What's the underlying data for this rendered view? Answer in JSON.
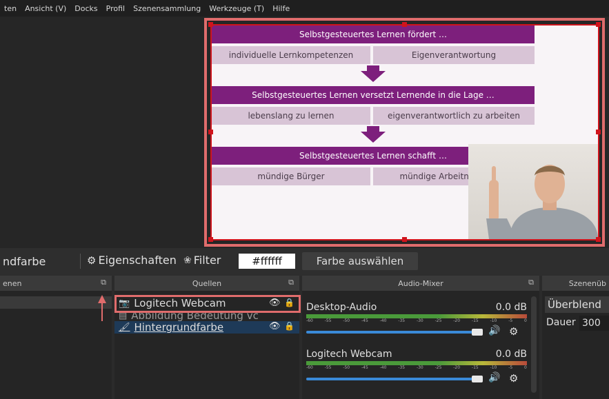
{
  "menu": [
    "ten",
    "Ansicht (V)",
    "Docks",
    "Profil",
    "Szenensammlung",
    "Werkzeuge (T)",
    "Hilfe"
  ],
  "slide": {
    "row1_header": "Selbstgesteuertes Lernen fördert …",
    "row1_left": "individuelle Lernkompetenzen",
    "row1_right": "Eigenverantwortung",
    "row2_header": "Selbstgesteuertes Lernen versetzt Lernende in die Lage …",
    "row2_left": "lebenslang zu lernen",
    "row2_right": "eigenverantwortlich zu arbeiten",
    "row3_header": "Selbstgesteuertes Lernen schafft …",
    "row3_left": "mündige Bürger",
    "row3_right": "mündige Arbeitnehmende"
  },
  "toolbar": {
    "label_left": "ndfarbe",
    "properties": "Eigenschaften",
    "filter": "Filter",
    "color_value": "#ffffff",
    "choose_color": "Farbe auswählen"
  },
  "docks": {
    "scenes_title": "enen",
    "sources_title": "Quellen",
    "mixer_title": "Audio-Mixer",
    "transitions_title": "Szenenüb"
  },
  "sources": [
    {
      "label": "Logitech Webcam",
      "icon": "camera-icon"
    },
    {
      "label": "Abbildung Bedeutung vc",
      "icon": "image-icon"
    },
    {
      "label": "Hintergrundfarbe",
      "icon": "brush-icon"
    }
  ],
  "mixer": [
    {
      "name": "Desktop-Audio",
      "db": "0.0 dB"
    },
    {
      "name": "Logitech Webcam",
      "db": "0.0 dB"
    }
  ],
  "mixer_ticks": [
    "-60",
    "-55",
    "-50",
    "-45",
    "-40",
    "-35",
    "-30",
    "-25",
    "-20",
    "-15",
    "-10",
    "-5",
    "0"
  ],
  "transitions": {
    "dropdown": "Überblend",
    "duration_label": "Dauer",
    "duration_value": "300"
  },
  "colors": {
    "accent_red": "#e06c6c",
    "slide_purple": "#7d1f7c",
    "slide_cell": "#d8c4d6"
  }
}
